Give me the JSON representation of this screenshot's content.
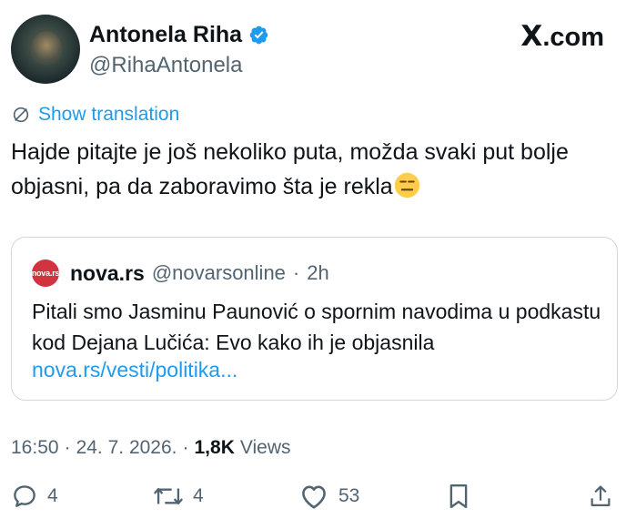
{
  "author": {
    "display_name": "Antonela Riha",
    "handle": "@RihaAntonela"
  },
  "brand": {
    "x": "X",
    "suffix": ".com"
  },
  "translation": {
    "label": "Show translation"
  },
  "tweet": {
    "text": "Hajde pitajte je još nekoliko puta, možda svaki put bolje objasni, pa da zaboravimo šta je rekla"
  },
  "quote": {
    "logo_text": "nova.rs",
    "name": "nova.rs",
    "handle": "@novarsonline",
    "separator": "·",
    "time": "2h",
    "text": "Pitali smo Jasminu Paunović o spornim navodima u podkastu kod Dejana Lučića: Evo kako ih je objasnila",
    "link": "nova.rs/vesti/politika..."
  },
  "meta": {
    "time": "16:50",
    "sep1": "·",
    "date": "24. 7. 2026.",
    "sep2": "·",
    "views_count": "1,8K",
    "views_label": "Views"
  },
  "actions": {
    "replies": "4",
    "reposts": "4",
    "likes": "53"
  },
  "colors": {
    "accent": "#1d9bf0",
    "muted": "#536471",
    "text": "#0f1419",
    "border": "#cfd9de",
    "nova_brand": "#d1343f"
  },
  "icons": [
    "avatar",
    "verified-badge-icon",
    "x-logo",
    "translate-globe-icon",
    "neutral-face-emoji",
    "reply-icon",
    "repost-icon",
    "like-icon",
    "bookmark-icon",
    "share-icon"
  ]
}
